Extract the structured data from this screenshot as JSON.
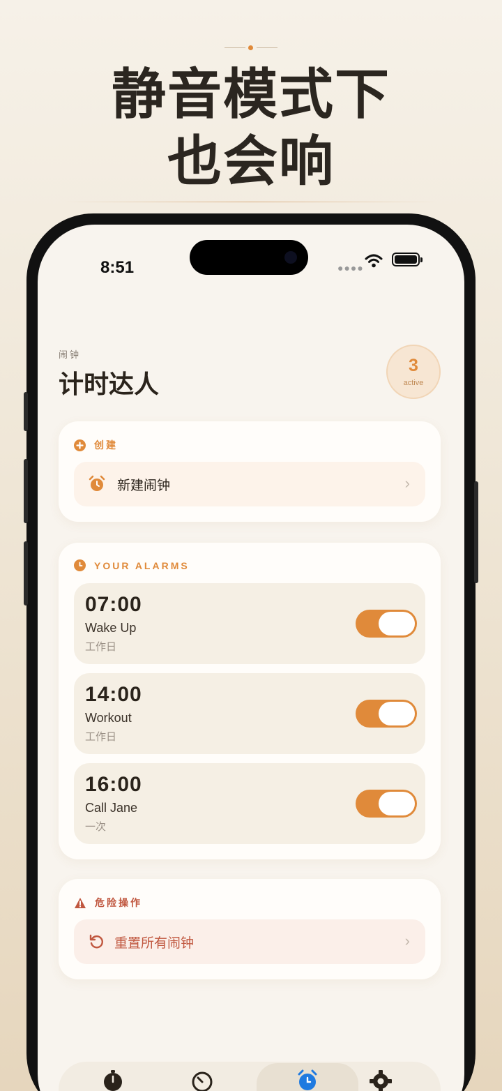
{
  "promo": {
    "line1": "静音模式下",
    "line2": "也会响"
  },
  "status_bar": {
    "time": "8:51"
  },
  "header": {
    "subtitle": "闹钟",
    "title": "计时达人",
    "active_count": "3",
    "active_label": "active"
  },
  "create_section": {
    "label": "创建",
    "new_alarm_label": "新建闹钟"
  },
  "alarms_section": {
    "label": "YOUR ALARMS",
    "items": [
      {
        "time": "07:00",
        "name": "Wake Up",
        "repeat": "工作日",
        "enabled": true
      },
      {
        "time": "14:00",
        "name": "Workout",
        "repeat": "工作日",
        "enabled": true
      },
      {
        "time": "16:00",
        "name": "Call Jane",
        "repeat": "一次",
        "enabled": true
      }
    ]
  },
  "danger_section": {
    "label": "危险操作",
    "reset_label": "重置所有闹钟"
  },
  "tabbar": {
    "tabs": [
      {
        "icon": "stopwatch-icon",
        "selected": false
      },
      {
        "icon": "timer-icon",
        "selected": false
      },
      {
        "icon": "alarm-clock-icon",
        "selected": true
      },
      {
        "icon": "gear-icon",
        "selected": false
      }
    ]
  },
  "colors": {
    "accent": "#e08a3a",
    "danger": "#c0573f",
    "selected_tab_icon": "#1f7ae0"
  }
}
